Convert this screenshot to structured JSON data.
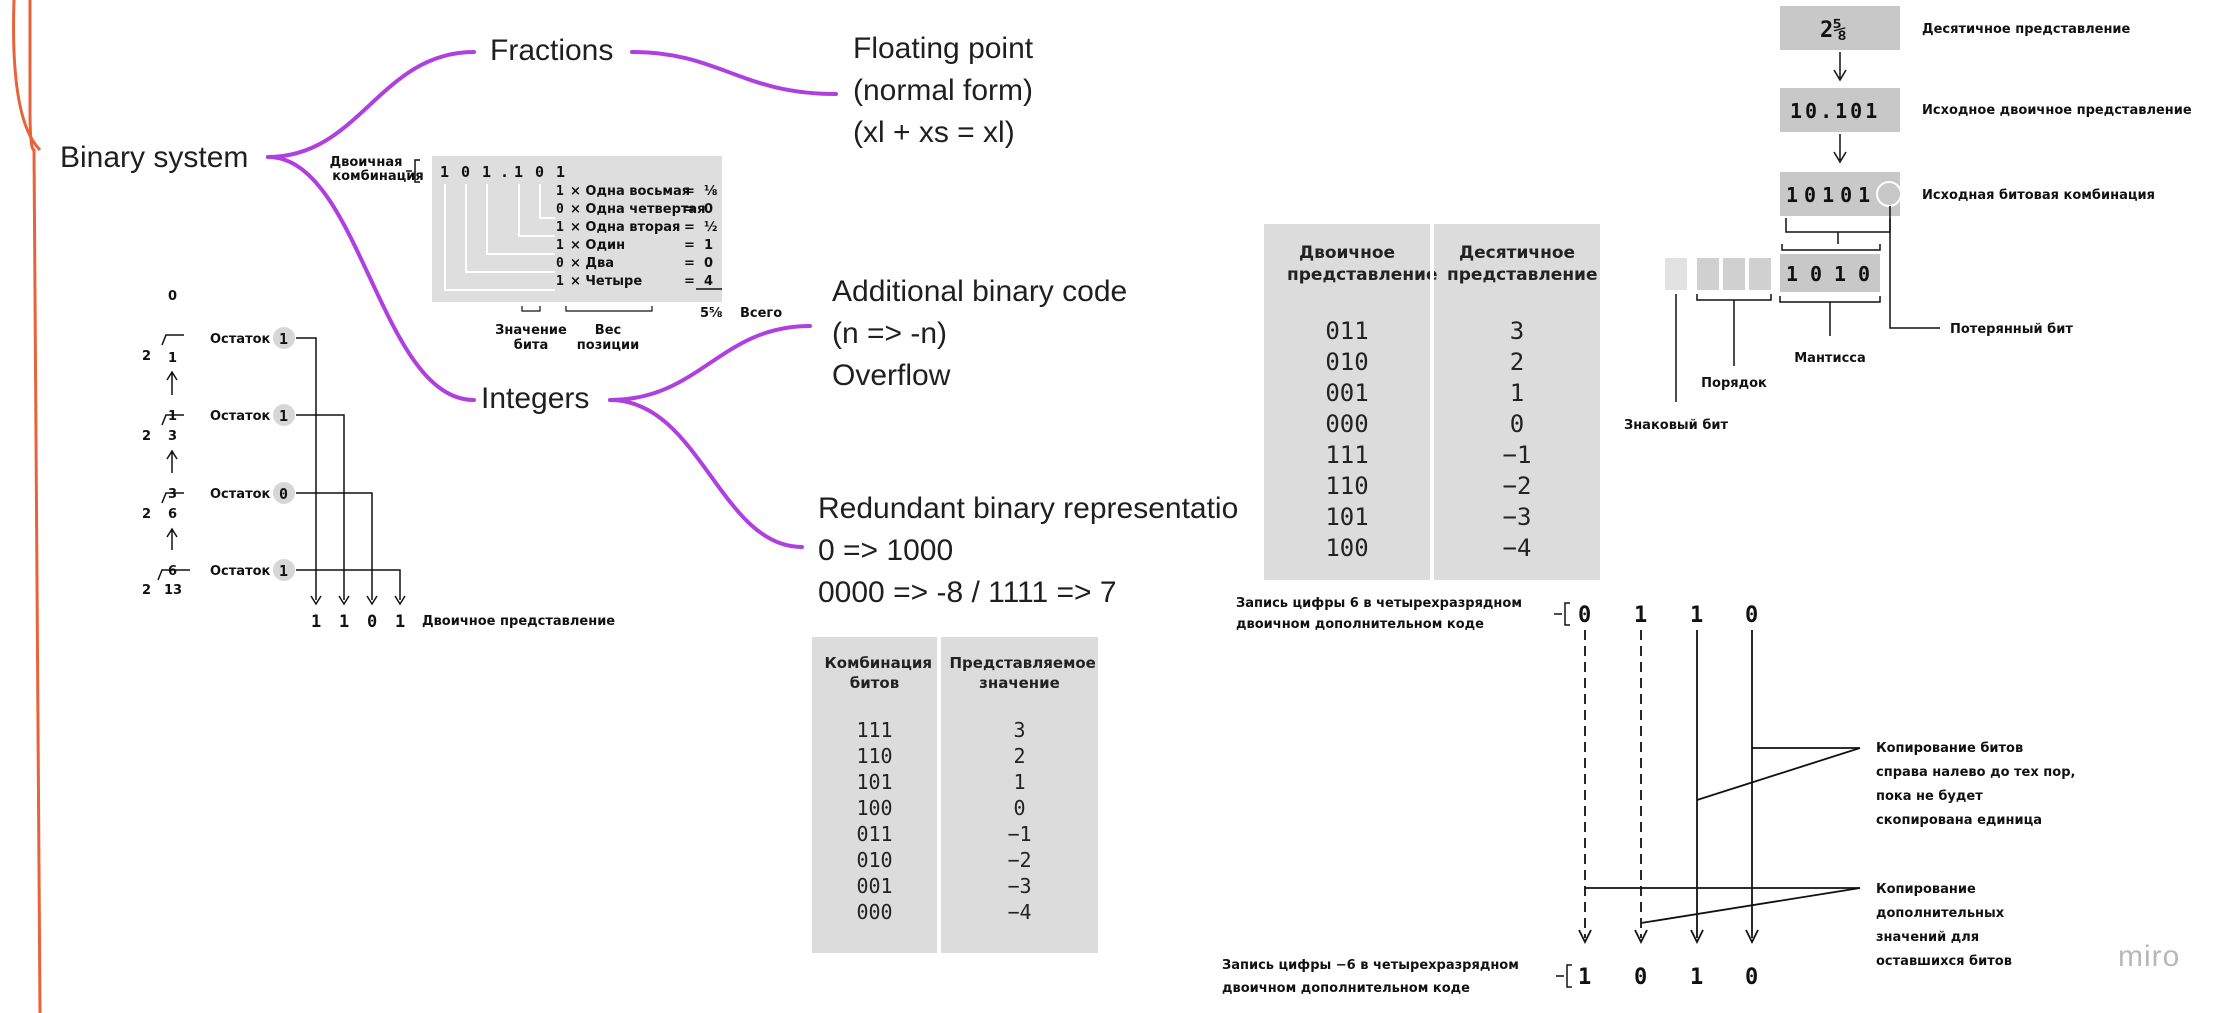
{
  "mindmap": {
    "root": "Binary system",
    "fractions": "Fractions",
    "integers": "Integers",
    "floating_point": [
      "Floating point",
      "(normal form)",
      "(xl + xs = xl)"
    ],
    "additional_code": [
      "Additional binary code",
      "(n => -n)",
      "Overflow"
    ],
    "redundant": [
      "Redundant binary representatio",
      "0 => 1000",
      "0000 => -8 / 1111 => 7"
    ]
  },
  "fraction_figure": {
    "label_line1": "Двоичная",
    "label_line2": "комбинация",
    "bits": [
      "1",
      "0",
      "1",
      ".",
      "1",
      "0",
      "1"
    ],
    "rows": [
      {
        "bit": "1",
        "text": "× Одна восьмая",
        "val": "⅛"
      },
      {
        "bit": "0",
        "text": "× Одна четвертая",
        "val": "0"
      },
      {
        "bit": "1",
        "text": "× Одна вторая",
        "val": "½"
      },
      {
        "bit": "1",
        "text": "× Один",
        "val": "1"
      },
      {
        "bit": "0",
        "text": "× Два",
        "val": "0"
      },
      {
        "bit": "1",
        "text": "× Четыре",
        "val": "4"
      }
    ],
    "total": "5⅝",
    "total_label": "Всего",
    "bit_value_1": "Значение",
    "bit_value_2": "бита",
    "weight_1": "Вес",
    "weight_2": "позиции"
  },
  "division_figure": {
    "remainder_label": "Остаток",
    "steps": [
      {
        "q": "0",
        "d": "1",
        "r": "1"
      },
      {
        "q": "1",
        "d": "3",
        "r": "1"
      },
      {
        "q": "3",
        "d": "6",
        "r": "0"
      },
      {
        "q": "6",
        "d": "13",
        "r": "1"
      }
    ],
    "divisor": "2",
    "result": [
      "1",
      "1",
      "0",
      "1"
    ],
    "result_label": "Двоичное представление"
  },
  "table_3bit": {
    "headers": [
      "Двоичное представление",
      "Десятичное представление"
    ],
    "rows": [
      [
        "011",
        "3"
      ],
      [
        "010",
        "2"
      ],
      [
        "001",
        "1"
      ],
      [
        "000",
        "0"
      ],
      [
        "111",
        "−1"
      ],
      [
        "110",
        "−2"
      ],
      [
        "101",
        "−3"
      ],
      [
        "100",
        "−4"
      ]
    ]
  },
  "table_excess": {
    "headers": [
      "Комбинация битов",
      "Представляемое значение"
    ],
    "rows": [
      [
        "111",
        "3"
      ],
      [
        "110",
        "2"
      ],
      [
        "101",
        "1"
      ],
      [
        "100",
        "0"
      ],
      [
        "011",
        "−1"
      ],
      [
        "010",
        "−2"
      ],
      [
        "001",
        "−3"
      ],
      [
        "000",
        "−4"
      ]
    ]
  },
  "float_figure": {
    "decimal": "2⅝",
    "decimal_label": "Десятичное представление",
    "binary": "10.101",
    "binary_label": "Исходное двоичное представление",
    "bits": "10101",
    "bits_label": "Исходная битовая комбинация",
    "mantissa_bits": [
      "1",
      "0",
      "1",
      "0"
    ],
    "lost_bit": "Потерянный бит",
    "mantissa": "Мантисса",
    "exponent": "Порядок",
    "sign_bit": "Знаковый бит"
  },
  "twos_figure": {
    "top_line1": "Запись цифры 6 в четырехразрядном",
    "top_line2": "двоичном дополнительном коде",
    "top_bits": [
      "0",
      "1",
      "1",
      "0"
    ],
    "copy_line1": "Копирование битов",
    "copy_line2": "справа налево до тех пор,",
    "copy_line3": "пока не будет",
    "copy_line4": "скопирована единица",
    "comp_line1": "Копирование",
    "comp_line2": "дополнительных",
    "comp_line3": "значений для",
    "comp_line4": "оставшихся битов",
    "bottom_line1": "Запись цифры −6 в четырехразрядном",
    "bottom_line2": "двоичном дополнительном коде",
    "bottom_bits": [
      "1",
      "0",
      "1",
      "0"
    ]
  },
  "watermark": "miro",
  "colors": {
    "branch": "#b03fe0",
    "frame": "#e8623a",
    "table_bg": "#dcdcdc"
  }
}
